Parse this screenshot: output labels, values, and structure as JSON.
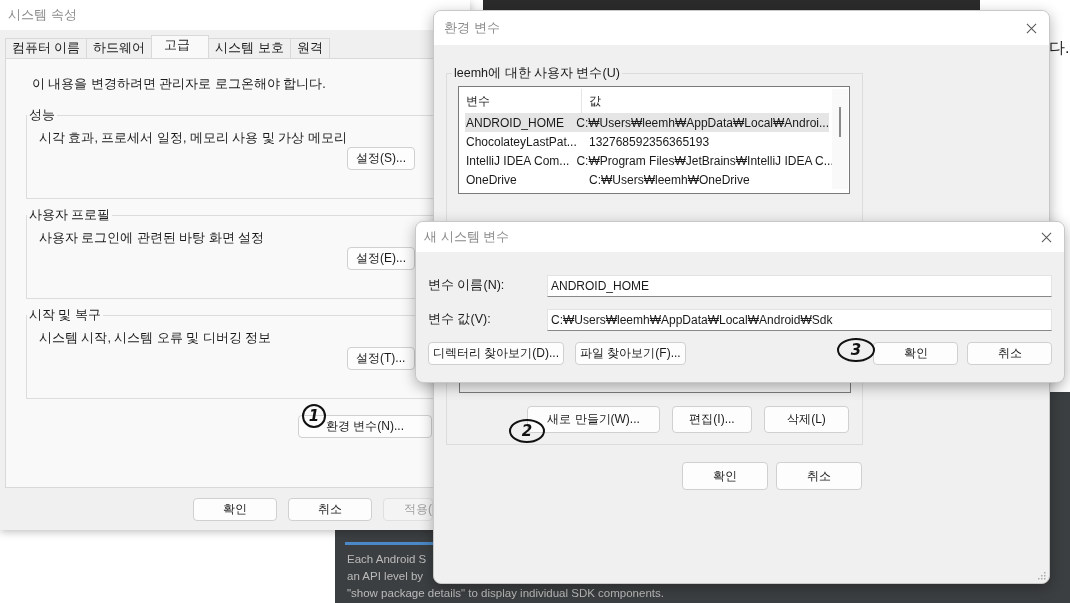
{
  "background": {
    "side_text": "다.",
    "android_lines": [
      "Each Android S",
      "an API level by",
      "\"show package details\" to display individual SDK components."
    ]
  },
  "system_properties": {
    "title": "시스템 속성",
    "tabs": [
      {
        "label": "컴퓨터 이름",
        "selected": false
      },
      {
        "label": "하드웨어",
        "selected": false
      },
      {
        "label": "고급",
        "selected": true
      },
      {
        "label": "시스템 보호",
        "selected": false
      },
      {
        "label": "원격",
        "selected": false
      }
    ],
    "notice": "이 내용을 변경하려면 관리자로 로그온해야 합니다.",
    "groups": [
      {
        "title": "성능",
        "description": "시각 효과, 프로세서 일정, 메모리 사용 및 가상 메모리",
        "button": "설정(S)..."
      },
      {
        "title": "사용자 프로필",
        "description": "사용자 로그인에 관련된 바탕 화면 설정",
        "button": "설정(E)..."
      },
      {
        "title": "시작 및 복구",
        "description": "시스템 시작, 시스템 오류 및 디버깅 정보",
        "button": "설정(T)..."
      }
    ],
    "env_button": "환경 변수(N)...",
    "buttons": [
      {
        "label": "확인",
        "disabled": false
      },
      {
        "label": "취소",
        "disabled": false
      },
      {
        "label": "적용(",
        "disabled": true
      }
    ]
  },
  "environment_variables": {
    "title": "환경 변수",
    "user_group": "leemh에 대한 사용자 변수(U)",
    "table": {
      "columns": [
        "변수",
        "값"
      ],
      "rows": [
        {
          "name": "ANDROID_HOME",
          "value": "C:₩Users₩leemh₩AppData₩Local₩Androi...",
          "selected": true
        },
        {
          "name": "ChocolateyLastPat...",
          "value": "132768592356365193",
          "selected": false
        },
        {
          "name": "IntelliJ IDEA Com...",
          "value": "C:₩Program Files₩JetBrains₩IntelliJ IDEA C...",
          "selected": false
        },
        {
          "name": "OneDrive",
          "value": "C:₩Users₩leemh₩OneDrive",
          "selected": false
        }
      ]
    },
    "system_buttons": [
      "새로 만들기(W)...",
      "편집(I)...",
      "삭제(L)"
    ],
    "buttons": [
      "확인",
      "취소"
    ]
  },
  "new_variable_dialog": {
    "title": "새 시스템 변수",
    "fields": [
      {
        "label": "변수 이름(N):",
        "value": "ANDROID_HOME"
      },
      {
        "label": "변수 값(V):",
        "value": "C:₩Users₩leemh₩AppData₩Local₩Android₩Sdk"
      }
    ],
    "browse_buttons": [
      "디렉터리 찾아보기(D)...",
      "파일 찾아보기(F)..."
    ],
    "buttons": [
      "확인",
      "취소"
    ]
  },
  "annotations": [
    "1",
    "2",
    "3"
  ]
}
